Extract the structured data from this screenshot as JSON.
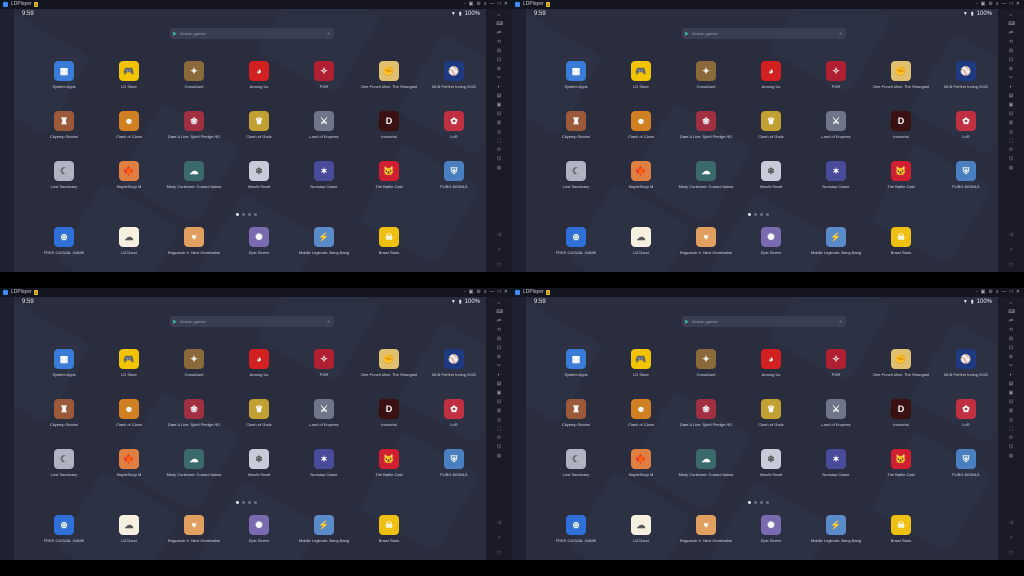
{
  "window": {
    "app_name": "LDPlayer",
    "version_badge": "9",
    "controls": [
      "▫",
      "▣",
      "⚙",
      "≡",
      "—",
      "□",
      "✕"
    ]
  },
  "status_bar": {
    "time": "9:59",
    "battery": "100%"
  },
  "search": {
    "placeholder": "Search games"
  },
  "apps": [
    {
      "label": "System Apps",
      "icon": "system-apps-icon",
      "color": "#3a7bd5",
      "glyph": "▦"
    },
    {
      "label": "LD Store",
      "icon": "ld-store-icon",
      "color": "#f2c400",
      "glyph": "🎮"
    },
    {
      "label": "CrossDuel",
      "icon": "crossduel-icon",
      "color": "#8a6a3a",
      "glyph": "✦"
    },
    {
      "label": "Among Us",
      "icon": "among-us-icon",
      "color": "#d32020",
      "glyph": "◕"
    },
    {
      "label": "PGR",
      "icon": "pgr-icon",
      "color": "#b02030",
      "glyph": "✧"
    },
    {
      "label": "One Punch Man: The Strongest",
      "icon": "one-punch-man-icon",
      "color": "#e0c070",
      "glyph": "✊"
    },
    {
      "label": "MLB Perfect Inning 2022",
      "icon": "mlb-perfect-inning-icon",
      "color": "#1e3a80",
      "glyph": "⚾"
    },
    {
      "label": "Cityemp Stories",
      "icon": "cityemp-stories-icon",
      "color": "#9a5a3a",
      "glyph": "♜"
    },
    {
      "label": "Clash of Clans",
      "icon": "clash-of-clans-icon",
      "color": "#d08020",
      "glyph": "☻"
    },
    {
      "label": "Date A Live: Spirit Pledge HD",
      "icon": "date-a-live-icon",
      "color": "#a03040",
      "glyph": "❀"
    },
    {
      "label": "Clash of Gods",
      "icon": "clash-of-gods-icon",
      "color": "#c0a030",
      "glyph": "♛"
    },
    {
      "label": "Land of Empires",
      "icon": "land-of-empires-icon",
      "color": "#70768a",
      "glyph": "⚔"
    },
    {
      "label": "Immortal",
      "icon": "immortal-icon",
      "color": "#3a1010",
      "glyph": "D"
    },
    {
      "label": "LoR",
      "icon": "lor-icon",
      "color": "#c03040",
      "glyph": "✿"
    },
    {
      "label": "Lost Sanctuary",
      "icon": "lost-sanctuary-icon",
      "color": "#b0b4c0",
      "glyph": "☾"
    },
    {
      "label": "MapleStory M",
      "icon": "maplestory-m-icon",
      "color": "#e08040",
      "glyph": "🍁"
    },
    {
      "label": "Misty Continent: Cursed Island",
      "icon": "misty-continent-icon",
      "color": "#3a6a6a",
      "glyph": "☁"
    },
    {
      "label": "Nival's Heart",
      "icon": "nivals-heart-icon",
      "color": "#c8ccd8",
      "glyph": "❄"
    },
    {
      "label": "Nonstop Game",
      "icon": "nonstop-game-icon",
      "color": "#4a4a9a",
      "glyph": "✶"
    },
    {
      "label": "The Battle Cats",
      "icon": "battle-cats-icon",
      "color": "#d02030",
      "glyph": "🐱"
    },
    {
      "label": "PUBG MOBILE",
      "icon": "pubg-mobile-icon",
      "color": "#4a80c0",
      "glyph": "⛨"
    }
  ],
  "dock": [
    {
      "label": "FREE CASUAL GAME",
      "icon": "free-casual-game-icon",
      "color": "#2f6fd8",
      "glyph": "⊕"
    },
    {
      "label": "LDCloud",
      "icon": "ldcloud-icon",
      "color": "#f5f0e0",
      "glyph": "☁"
    },
    {
      "label": "Ragnarok X: Next Generation",
      "icon": "ragnarok-x-icon",
      "color": "#e0a060",
      "glyph": "♥"
    },
    {
      "label": "Epic Seven",
      "icon": "epic-seven-icon",
      "color": "#7a6ab0",
      "glyph": "✺"
    },
    {
      "label": "Mobile Legends: Bang Bang",
      "icon": "mobile-legends-icon",
      "color": "#5a8ac8",
      "glyph": "⚡"
    },
    {
      "label": "Brawl Stars",
      "icon": "brawl-stars-icon",
      "color": "#f0c010",
      "glyph": "☠"
    }
  ],
  "page_dots": {
    "count": 4,
    "active": 0
  },
  "sidebar_buttons": [
    "⌂",
    "⌨",
    "⇄",
    "⟲",
    "⊞",
    "⊡",
    "⊕",
    "✂",
    "◐",
    "▤",
    "▣",
    "⊟",
    "⊠",
    "◎",
    "⬚",
    "⟳",
    "⌬",
    "◍"
  ],
  "nav_buttons": [
    "◁",
    "○",
    "□"
  ]
}
